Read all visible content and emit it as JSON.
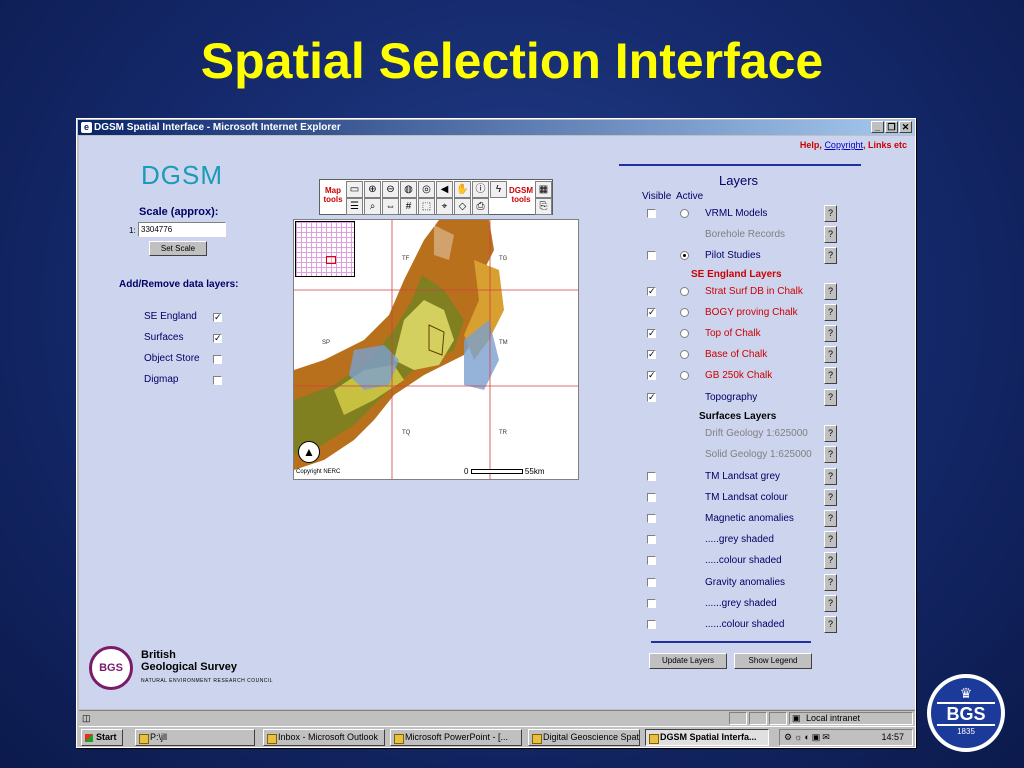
{
  "slide": {
    "title": "Spatial Selection Interface"
  },
  "window": {
    "title": "DGSM Spatial Interface - Microsoft Internet Explorer"
  },
  "links": {
    "help": "Help",
    "copyright": "Copyright",
    "links": "Links etc"
  },
  "logo": {
    "text": "DGSM"
  },
  "scale": {
    "label": "Scale (approx):",
    "prefix": "1:",
    "value": "3304776",
    "button": "Set Scale"
  },
  "data_layers": {
    "heading": "Add/Remove data layers:",
    "items": [
      {
        "label": "SE England",
        "checked": true
      },
      {
        "label": "Surfaces",
        "checked": true
      },
      {
        "label": "Object Store",
        "checked": false
      },
      {
        "label": "Digmap",
        "checked": false
      }
    ]
  },
  "toolbar": {
    "map_tools": "Map tools",
    "dgsm_tools": "DGSM tools"
  },
  "map": {
    "grid_labels": [
      "TF",
      "TG",
      "SP",
      "TM",
      "TQ",
      "TR"
    ],
    "copyright": "Copyright NERC",
    "scale_start": "0",
    "scale_end": "55km"
  },
  "layers": {
    "title": "Layers",
    "col_visible": "Visible",
    "col_active": "Active",
    "section_se": "SE England Layers",
    "section_surfaces": "Surfaces Layers",
    "rows": [
      {
        "name": "VRML Models",
        "visible": false,
        "active": "off",
        "color": "#000066"
      },
      {
        "name": "Borehole Records",
        "visible": null,
        "active": null,
        "color": "#808080"
      },
      {
        "name": "Pilot Studies",
        "visible": false,
        "active": "on",
        "color": "#000066"
      },
      {
        "name": "Strat Surf DB in Chalk",
        "visible": true,
        "active": "off",
        "color": "#cc0000"
      },
      {
        "name": "BOGY proving Chalk",
        "visible": true,
        "active": "off",
        "color": "#cc0000"
      },
      {
        "name": "Top of Chalk",
        "visible": true,
        "active": "off",
        "color": "#cc0000"
      },
      {
        "name": "Base of Chalk",
        "visible": true,
        "active": "off",
        "color": "#cc0000"
      },
      {
        "name": "GB 250k Chalk",
        "visible": true,
        "active": "off",
        "color": "#cc0000"
      },
      {
        "name": "Topography",
        "visible": true,
        "active": null,
        "color": "#000066"
      },
      {
        "name": "Drift Geology 1:625000",
        "visible": null,
        "active": null,
        "color": "#808080"
      },
      {
        "name": "Solid Geology 1:625000",
        "visible": null,
        "active": null,
        "color": "#808080"
      },
      {
        "name": "TM Landsat grey",
        "visible": false,
        "active": null,
        "color": "#000066"
      },
      {
        "name": "TM Landsat colour",
        "visible": false,
        "active": null,
        "color": "#000066"
      },
      {
        "name": "Magnetic anomalies",
        "visible": false,
        "active": null,
        "color": "#000066"
      },
      {
        "name": ".....grey shaded",
        "visible": false,
        "active": null,
        "color": "#000066"
      },
      {
        "name": ".....colour shaded",
        "visible": false,
        "active": null,
        "color": "#000066"
      },
      {
        "name": "Gravity anomalies",
        "visible": false,
        "active": null,
        "color": "#000066"
      },
      {
        "name": "......grey shaded",
        "visible": false,
        "active": null,
        "color": "#000066"
      },
      {
        "name": "......colour shaded",
        "visible": false,
        "active": null,
        "color": "#000066"
      }
    ],
    "update_button": "Update Layers",
    "legend_button": "Show Legend"
  },
  "org": {
    "name_line1": "British",
    "name_line2": "Geological Survey",
    "tagline": "NATURAL ENVIRONMENT RESEARCH COUNCIL",
    "logo_text": "BGS"
  },
  "status": {
    "zone": "Local intranet"
  },
  "taskbar": {
    "start": "Start",
    "tasks": [
      "P:\\jll",
      "Inbox - Microsoft Outlook",
      "Microsoft PowerPoint - [...",
      "Digital Geoscience Spati...",
      "DGSM Spatial Interfa..."
    ],
    "active_index": 4,
    "clock": "14:57"
  },
  "seal": {
    "letters": "BGS",
    "year": "1835"
  }
}
